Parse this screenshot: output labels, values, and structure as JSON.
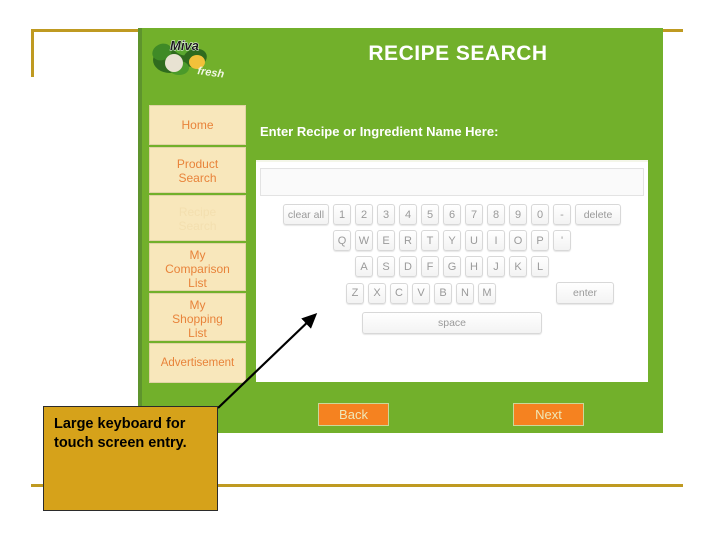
{
  "slide": {
    "frame_color": "#BF9A21"
  },
  "kiosk": {
    "background_color": "#72B02B",
    "logo_name": "miva-fresh-logo",
    "logo_text": "Miva Fresh",
    "title": "RECIPE SEARCH",
    "prompt": "Enter Recipe or Ingredient Name Here:",
    "search_value": "",
    "search_placeholder": ""
  },
  "sidebar": {
    "items": [
      {
        "label": "Home",
        "disabled": false
      },
      {
        "label": "Product\nSearch",
        "line1": "Product",
        "line2": "Search",
        "disabled": false
      },
      {
        "label": "Recipe\nSearch",
        "line1": "Recipe",
        "line2": "Search",
        "disabled": true
      },
      {
        "label": "My Comparison List",
        "line1": "My",
        "line2": "Comparison",
        "line3": "List",
        "disabled": false
      },
      {
        "label": "My Shopping List",
        "line1": "My",
        "line2": "Shopping",
        "line3": "List",
        "disabled": false
      },
      {
        "label": "Advertisement",
        "disabled": false
      }
    ]
  },
  "keyboard": {
    "row_numbers": [
      "clear all",
      "1",
      "2",
      "3",
      "4",
      "5",
      "6",
      "7",
      "8",
      "9",
      "0",
      "-",
      "delete"
    ],
    "row1": [
      "Q",
      "W",
      "E",
      "R",
      "T",
      "Y",
      "U",
      "I",
      "O",
      "P",
      "'"
    ],
    "row2": [
      "A",
      "S",
      "D",
      "F",
      "G",
      "H",
      "J",
      "K",
      "L"
    ],
    "row3": [
      "Z",
      "X",
      "C",
      "V",
      "B",
      "N",
      "M"
    ],
    "enter_label": "enter",
    "space_label": "space",
    "clear_all_label": "clear all",
    "delete_label": "delete"
  },
  "footer": {
    "back_label": "Back",
    "next_label": "Next",
    "button_color": "#F58220"
  },
  "callout": {
    "text": "Large keyboard for touch screen entry.",
    "background_color": "#D6A21A"
  }
}
